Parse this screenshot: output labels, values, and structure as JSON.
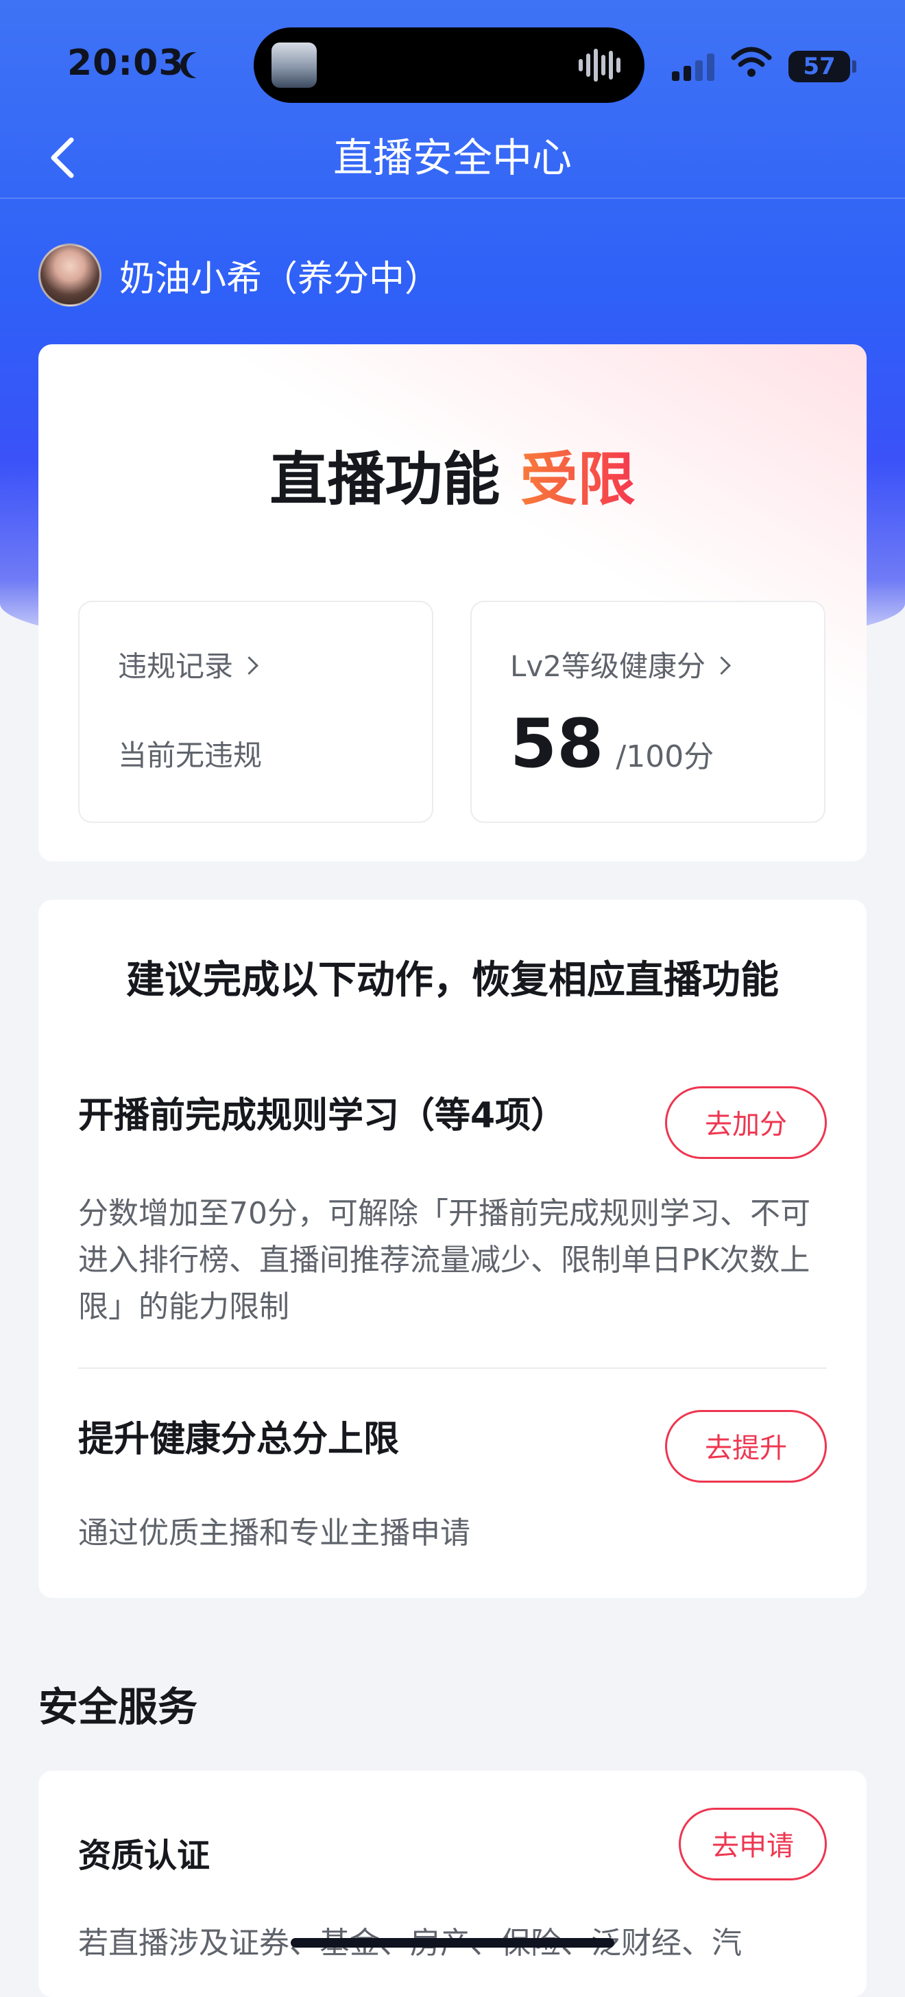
{
  "status_bar": {
    "time": "20:03",
    "battery": "57"
  },
  "nav": {
    "title": "直播安全中心"
  },
  "user": {
    "name": "奶油小希（养分中）"
  },
  "status_card": {
    "title_prefix": "直播功能",
    "title_highlight": "受限",
    "violations": {
      "label": "违规记录",
      "value": "当前无违规"
    },
    "health": {
      "label": "Lv2等级健康分",
      "score": "58",
      "unit": "/100分"
    }
  },
  "actions_card": {
    "title": "建议完成以下动作，恢复相应直播功能",
    "items": [
      {
        "title": "开播前完成规则学习（等4项）",
        "button": "去加分",
        "desc": "分数增加至70分，可解除「开播前完成规则学习、不可进入排行榜、直播间推荐流量减少、限制单日PK次数上限」的能力限制"
      },
      {
        "title": "提升健康分总分上限",
        "button": "去提升",
        "desc": "通过优质主播和专业主播申请"
      }
    ]
  },
  "safety_services": {
    "title": "安全服务",
    "items": [
      {
        "title": "资质认证",
        "button": "去申请",
        "desc": "若直播涉及证券、基金、房产、保险、泛财经、汽"
      }
    ]
  },
  "colors": {
    "accent_red": "#ee3650",
    "hero_blue": "#2f60f7"
  }
}
